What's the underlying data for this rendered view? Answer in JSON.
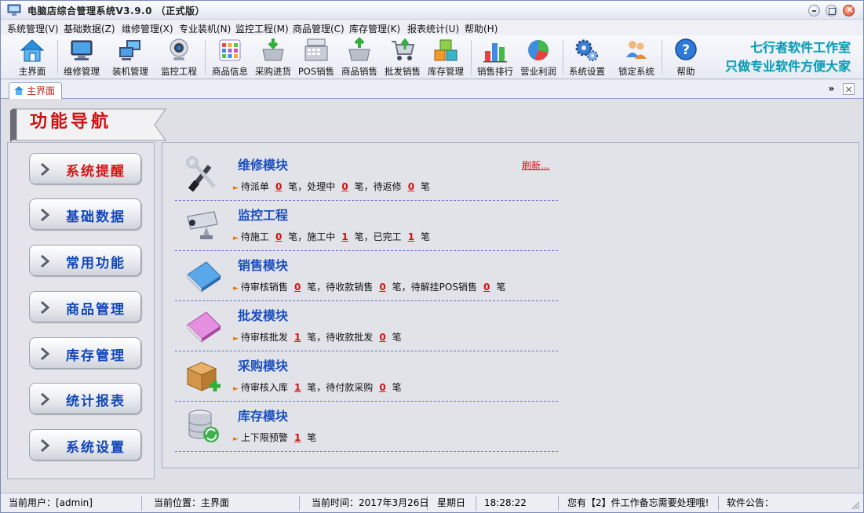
{
  "window": {
    "title": "电脑店综合管理系统V3.9.0 （正式版）"
  },
  "menu": [
    {
      "label": "系统管理(V)"
    },
    {
      "label": "基础数据(Z)"
    },
    {
      "label": "维修管理(X)"
    },
    {
      "label": "专业装机(N)"
    },
    {
      "label": "监控工程(M)"
    },
    {
      "label": "商品管理(C)"
    },
    {
      "label": "库存管理(K)"
    },
    {
      "label": "报表统计(U)"
    },
    {
      "label": "帮助(H)"
    }
  ],
  "toolbar": {
    "items": [
      {
        "label": "主界面",
        "icon": "home-icon"
      },
      {
        "label": "维修管理",
        "icon": "monitor-icon"
      },
      {
        "label": "装机管理",
        "icon": "computers-icon"
      },
      {
        "label": "监控工程",
        "icon": "webcam-icon"
      },
      {
        "label": "商品信息",
        "icon": "grid-icon"
      },
      {
        "label": "采购进货",
        "icon": "basket-in-icon"
      },
      {
        "label": "POS销售",
        "icon": "cash-register-icon"
      },
      {
        "label": "商品销售",
        "icon": "basket-out-icon"
      },
      {
        "label": "批发销售",
        "icon": "cart-icon"
      },
      {
        "label": "库存管理",
        "icon": "boxes-icon"
      },
      {
        "label": "销售排行",
        "icon": "bar-chart-icon"
      },
      {
        "label": "营业利润",
        "icon": "pie-chart-icon"
      },
      {
        "label": "系统设置",
        "icon": "gears-icon"
      },
      {
        "label": "锁定系统",
        "icon": "users-lock-icon"
      },
      {
        "label": "帮助",
        "icon": "help-icon"
      }
    ],
    "slogan_line1": "七行者软件工作室",
    "slogan_line2": "只做专业软件方便大家"
  },
  "tabs": {
    "active_label": "主界面"
  },
  "nav": {
    "title": "功能导航",
    "items": [
      {
        "label": "系统提醒"
      },
      {
        "label": "基础数据"
      },
      {
        "label": "常用功能"
      },
      {
        "label": "商品管理"
      },
      {
        "label": "库存管理"
      },
      {
        "label": "统计报表"
      },
      {
        "label": "系统设置"
      }
    ]
  },
  "refresh_label": "刷新...",
  "modules": [
    {
      "title": "维修模块",
      "icon": "tools-icon",
      "parts": [
        {
          "label": "待派单",
          "value": "0",
          "suffix": "笔，处理中"
        },
        {
          "value": "0",
          "suffix": "笔，待返修"
        },
        {
          "value": "0",
          "suffix": "笔"
        }
      ]
    },
    {
      "title": "监控工程",
      "icon": "cctv-camera-icon",
      "parts": [
        {
          "label": "待施工",
          "value": "0",
          "suffix": "笔，施工中"
        },
        {
          "value": "1",
          "suffix": "笔，已完工"
        },
        {
          "value": "1",
          "suffix": "笔"
        }
      ]
    },
    {
      "title": "销售模块",
      "icon": "blue-book-icon",
      "parts": [
        {
          "label": "待审核销售",
          "value": "0",
          "suffix": "笔，待收款销售"
        },
        {
          "value": "0",
          "suffix": "笔，待解挂POS销售"
        },
        {
          "value": "0",
          "suffix": "笔"
        }
      ]
    },
    {
      "title": "批发模块",
      "icon": "pink-book-icon",
      "parts": [
        {
          "label": "待审核批发",
          "value": "1",
          "suffix": "笔，待收款批发"
        },
        {
          "value": "0",
          "suffix": "笔"
        }
      ]
    },
    {
      "title": "采购模块",
      "icon": "box-add-icon",
      "parts": [
        {
          "label": "待审核入库",
          "value": "1",
          "suffix": "笔，待付款采购"
        },
        {
          "value": "0",
          "suffix": "笔"
        }
      ]
    },
    {
      "title": "库存模块",
      "icon": "database-sync-icon",
      "parts": [
        {
          "label": "上下限预警",
          "value": "1",
          "suffix": "笔"
        }
      ]
    }
  ],
  "status": {
    "user": "当前用户：[admin]",
    "location": "当前位置：主界面",
    "time": "当前时间：2017年3月26日",
    "weekday": "星期日",
    "clock": "18:28:22",
    "memo": "您有【2】件工作备忘需要处理哦!",
    "notice": "软件公告："
  },
  "colors": {
    "accent_red": "#d41010",
    "nav_blue": "#1247b9",
    "slogan": "#0d9bb5"
  }
}
